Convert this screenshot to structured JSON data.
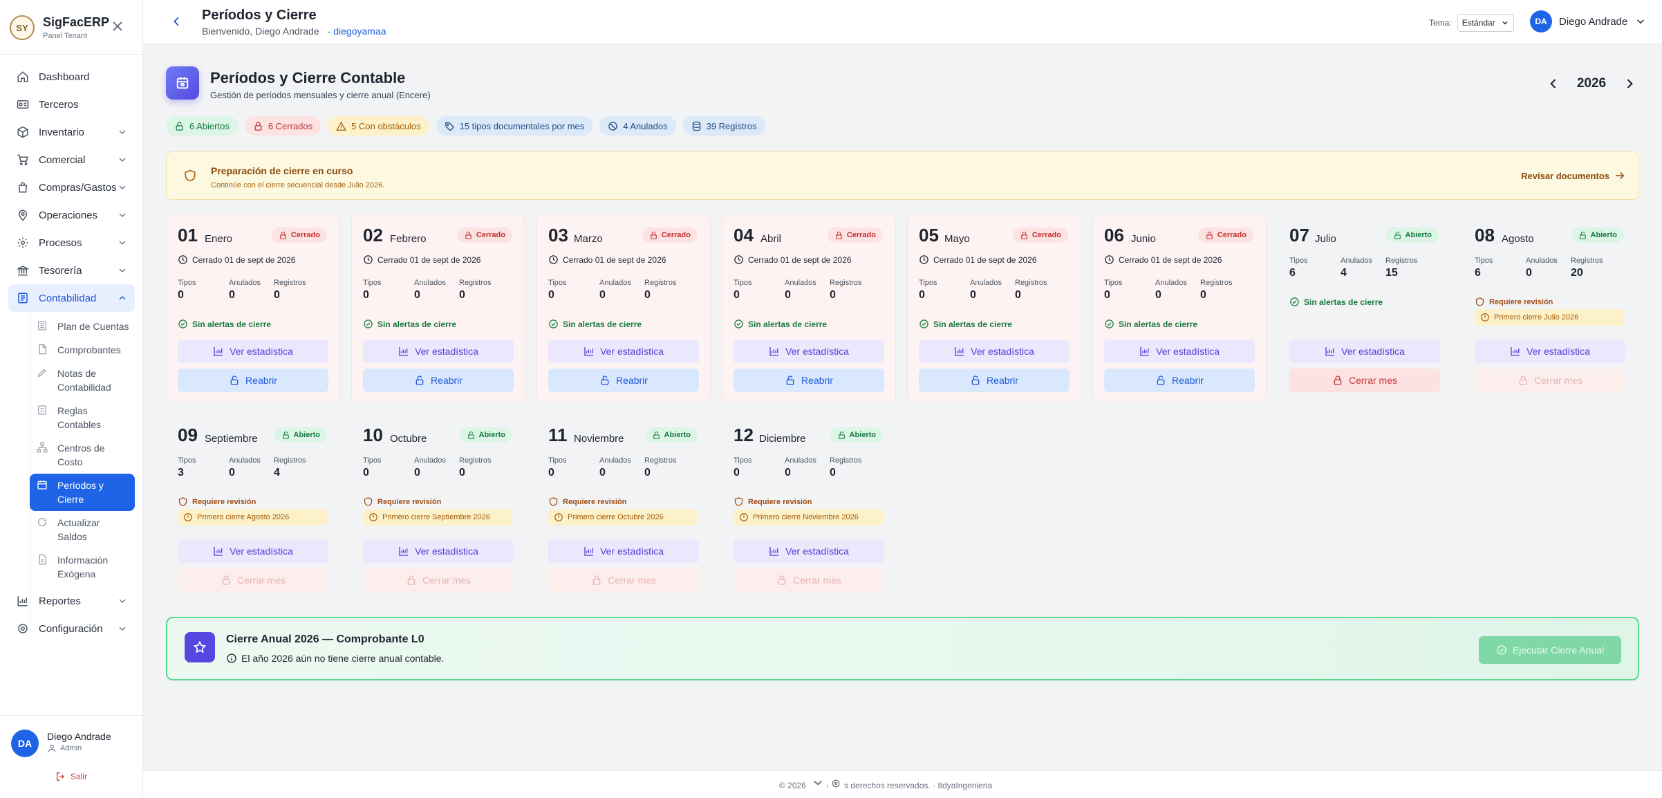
{
  "brand": {
    "logo_text": "SY",
    "name": "SigFacERP",
    "subtitle": "Panel Tenant"
  },
  "sidebar": {
    "items": [
      {
        "label": "Dashboard",
        "icon": "home-icon"
      },
      {
        "label": "Terceros",
        "icon": "id-card-icon"
      },
      {
        "label": "Inventario",
        "icon": "box-icon"
      },
      {
        "label": "Comercial",
        "icon": "cart-icon"
      },
      {
        "label": "Compras/Gastos",
        "icon": "bag-icon"
      },
      {
        "label": "Operaciones",
        "icon": "map-pin-icon"
      },
      {
        "label": "Procesos",
        "icon": "gear-icon"
      },
      {
        "label": "Tesorería",
        "icon": "bank-icon"
      },
      {
        "label": "Contabilidad",
        "icon": "ledger-icon"
      }
    ],
    "sub_items": [
      {
        "label": "Plan de Cuentas"
      },
      {
        "label": "Comprobantes"
      },
      {
        "label": "Notas de Contabilidad"
      },
      {
        "label": "Reglas Contables"
      },
      {
        "label": "Centros de Costo"
      },
      {
        "label": "Períodos y Cierre"
      },
      {
        "label": "Actualizar Saldos"
      },
      {
        "label": "Información Exógena"
      }
    ],
    "bottom_items": [
      {
        "label": "Reportes",
        "icon": "bar-chart-icon"
      },
      {
        "label": "Configuración",
        "icon": "gear-icon"
      }
    ]
  },
  "user": {
    "initials": "DA",
    "name": "Diego Andrade",
    "role": "Admin",
    "logout": "Salir"
  },
  "topbar": {
    "title": "Períodos y Cierre",
    "welcome": "Bienvenido, Diego Andrade",
    "handle": "- diegoyamaa",
    "theme_label": "Tema:",
    "theme_value": "Estándar"
  },
  "header": {
    "title": "Períodos y Cierre Contable",
    "subtitle": "Gestión de períodos mensuales y cierre anual (Encere)",
    "year": "2026"
  },
  "chips": [
    {
      "label": "6 Abiertos",
      "tone": "green",
      "icon": "lock-open-icon"
    },
    {
      "label": "6 Cerrados",
      "tone": "red",
      "icon": "lock-icon"
    },
    {
      "label": "5 Con obstáculos",
      "tone": "yellow",
      "icon": "warning-icon"
    },
    {
      "label": "15 tipos documentales por mes",
      "tone": "blue",
      "icon": "tag-icon"
    },
    {
      "label": "4 Anulados",
      "tone": "blue",
      "icon": "ban-icon"
    },
    {
      "label": "39 Registros",
      "tone": "blue",
      "icon": "database-icon"
    }
  ],
  "banner": {
    "title": "Preparación de cierre en curso",
    "subtitle": "Continúe con el cierre secuencial desde Julio 2026.",
    "action": "Revisar documentos"
  },
  "labels": {
    "tipos": "Tipos",
    "anulados": "Anulados",
    "registros": "Registros",
    "sin_alertas": "Sin alertas de cierre",
    "requiere": "Requiere revisión",
    "ver": "Ver estadística",
    "reabrir": "Reabrir",
    "cerrar": "Cerrar mes"
  },
  "periods": [
    {
      "num": "01",
      "month": "Enero",
      "status": "Cerrado",
      "date": "Cerrado 01 de sept de 2026",
      "tipos": "0",
      "anulados": "0",
      "registros": "0"
    },
    {
      "num": "02",
      "month": "Febrero",
      "status": "Cerrado",
      "date": "Cerrado 01 de sept de 2026",
      "tipos": "0",
      "anulados": "0",
      "registros": "0"
    },
    {
      "num": "03",
      "month": "Marzo",
      "status": "Cerrado",
      "date": "Cerrado 01 de sept de 2026",
      "tipos": "0",
      "anulados": "0",
      "registros": "0"
    },
    {
      "num": "04",
      "month": "Abril",
      "status": "Cerrado",
      "date": "Cerrado 01 de sept de 2026",
      "tipos": "0",
      "anulados": "0",
      "registros": "0"
    },
    {
      "num": "05",
      "month": "Mayo",
      "status": "Cerrado",
      "date": "Cerrado 01 de sept de 2026",
      "tipos": "0",
      "anulados": "0",
      "registros": "0"
    },
    {
      "num": "06",
      "month": "Junio",
      "status": "Cerrado",
      "date": "Cerrado 01 de sept de 2026",
      "tipos": "0",
      "anulados": "0",
      "registros": "0"
    },
    {
      "num": "07",
      "month": "Julio",
      "status": "Abierto",
      "tipos": "6",
      "anulados": "4",
      "registros": "15"
    },
    {
      "num": "08",
      "month": "Agosto",
      "status": "Abierto",
      "tipos": "6",
      "anulados": "0",
      "registros": "20",
      "note": "Primero cierre Julio 2026"
    },
    {
      "num": "09",
      "month": "Septiembre",
      "status": "Abierto",
      "tipos": "3",
      "anulados": "0",
      "registros": "4",
      "note": "Primero cierre Agosto 2026"
    },
    {
      "num": "10",
      "month": "Octubre",
      "status": "Abierto",
      "tipos": "0",
      "anulados": "0",
      "registros": "0",
      "note": "Primero cierre Septiembre 2026"
    },
    {
      "num": "11",
      "month": "Noviembre",
      "status": "Abierto",
      "tipos": "0",
      "anulados": "0",
      "registros": "0",
      "note": "Primero cierre Octubre 2026"
    },
    {
      "num": "12",
      "month": "Diciembre",
      "status": "Abierto",
      "tipos": "0",
      "anulados": "0",
      "registros": "0",
      "note": "Primero cierre Noviembre 2026"
    }
  ],
  "annual": {
    "title": "Cierre Anual 2026 — Comprobante L0",
    "subtitle": "El año 2026 aún no tiene cierre anual contable.",
    "button": "Ejecutar Cierre Anual"
  },
  "footer": {
    "text": "© 2026 · Todos los derechos reservados. · ItdyaIngenieria"
  },
  "colors": {
    "primary": "#1f64e6",
    "closed": "#c13131",
    "open": "#177a3e",
    "accent": "#5548e0"
  }
}
